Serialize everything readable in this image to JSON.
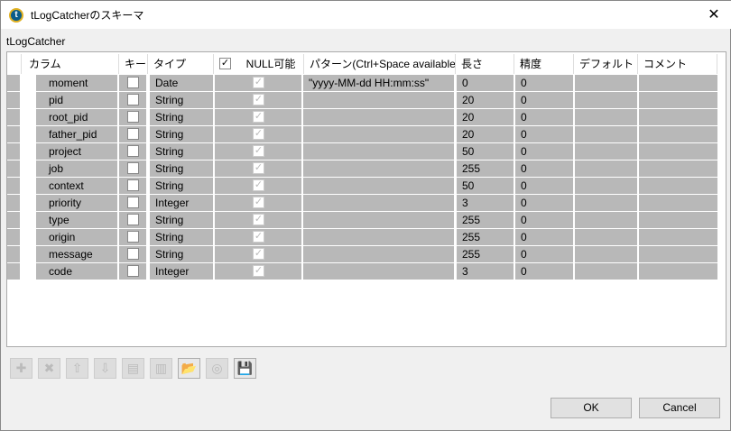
{
  "window": {
    "title": "tLogCatcherのスキーマ",
    "close": "✕",
    "icon": "t"
  },
  "component_label": "tLogCatcher",
  "columns": {
    "name": "カラム",
    "key": "キー",
    "type": "タイプ",
    "nullable": "NULL可能",
    "pattern": "パターン(Ctrl+Space available)",
    "length": "長さ",
    "precision": "精度",
    "default": "デフォルト",
    "comment": "コメント"
  },
  "rows": [
    {
      "name": "moment",
      "key": false,
      "type": "Date",
      "nullable": true,
      "pattern": "\"yyyy-MM-dd HH:mm:ss\"",
      "length": "0",
      "precision": "0"
    },
    {
      "name": "pid",
      "key": false,
      "type": "String",
      "nullable": true,
      "pattern": "",
      "length": "20",
      "precision": "0"
    },
    {
      "name": "root_pid",
      "key": false,
      "type": "String",
      "nullable": true,
      "pattern": "",
      "length": "20",
      "precision": "0"
    },
    {
      "name": "father_pid",
      "key": false,
      "type": "String",
      "nullable": true,
      "pattern": "",
      "length": "20",
      "precision": "0"
    },
    {
      "name": "project",
      "key": false,
      "type": "String",
      "nullable": true,
      "pattern": "",
      "length": "50",
      "precision": "0"
    },
    {
      "name": "job",
      "key": false,
      "type": "String",
      "nullable": true,
      "pattern": "",
      "length": "255",
      "precision": "0"
    },
    {
      "name": "context",
      "key": false,
      "type": "String",
      "nullable": true,
      "pattern": "",
      "length": "50",
      "precision": "0"
    },
    {
      "name": "priority",
      "key": false,
      "type": "Integer",
      "nullable": true,
      "pattern": "",
      "length": "3",
      "precision": "0"
    },
    {
      "name": "type",
      "key": false,
      "type": "String",
      "nullable": true,
      "pattern": "",
      "length": "255",
      "precision": "0"
    },
    {
      "name": "origin",
      "key": false,
      "type": "String",
      "nullable": true,
      "pattern": "",
      "length": "255",
      "precision": "0"
    },
    {
      "name": "message",
      "key": false,
      "type": "String",
      "nullable": true,
      "pattern": "",
      "length": "255",
      "precision": "0"
    },
    {
      "name": "code",
      "key": false,
      "type": "Integer",
      "nullable": true,
      "pattern": "",
      "length": "3",
      "precision": "0"
    }
  ],
  "toolbar": [
    {
      "name": "add",
      "icon": "plus-icon",
      "glyph": "✚",
      "enabled": false
    },
    {
      "name": "remove",
      "icon": "delete-icon",
      "glyph": "✖",
      "enabled": false
    },
    {
      "name": "move-up",
      "icon": "arrow-up-icon",
      "glyph": "⇧",
      "enabled": false
    },
    {
      "name": "move-down",
      "icon": "arrow-down-icon",
      "glyph": "⇩",
      "enabled": false
    },
    {
      "name": "copy",
      "icon": "copy-icon",
      "glyph": "▤",
      "enabled": false
    },
    {
      "name": "paste",
      "icon": "paste-icon",
      "glyph": "▥",
      "enabled": false
    },
    {
      "name": "import",
      "icon": "folder-import-icon",
      "glyph": "📂",
      "enabled": true
    },
    {
      "name": "export",
      "icon": "export-icon",
      "glyph": "◎",
      "enabled": false
    },
    {
      "name": "save",
      "icon": "save-icon",
      "glyph": "💾",
      "enabled": true
    }
  ],
  "buttons": {
    "ok": "OK",
    "cancel": "Cancel"
  }
}
